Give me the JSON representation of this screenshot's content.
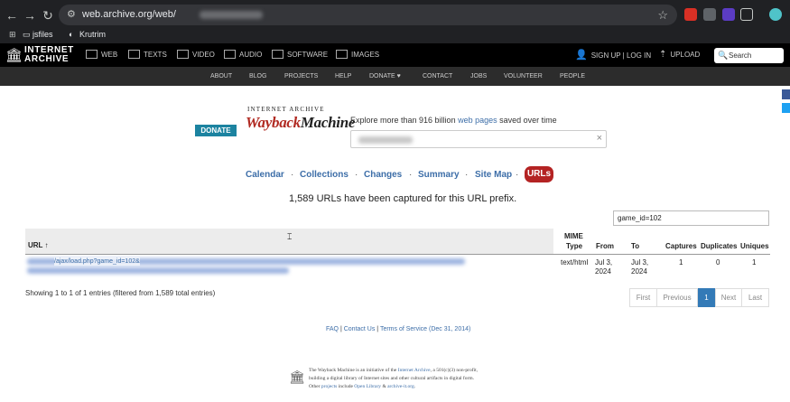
{
  "browser": {
    "url_visible": "web.archive.org/web/",
    "bookmarks": [
      "jsfiles",
      "Krutrim"
    ],
    "icons": [
      "back-icon",
      "forward-icon",
      "reload-icon",
      "site-info-icon",
      "star-icon",
      "apps-icon"
    ]
  },
  "ia_top": {
    "logo_line1": "INTERNET",
    "logo_line2": "ARCHIVE",
    "items": [
      "WEB",
      "TEXTS",
      "VIDEO",
      "AUDIO",
      "SOFTWARE",
      "IMAGES"
    ],
    "signup": "SIGN UP | LOG IN",
    "upload": "UPLOAD",
    "search_placeholder": "Search"
  },
  "ia_sub": [
    "ABOUT",
    "BLOG",
    "PROJECTS",
    "HELP",
    "DONATE ♥",
    "CONTACT",
    "JOBS",
    "VOLUNTEER",
    "PEOPLE"
  ],
  "wayback": {
    "donate": "DONATE",
    "logo_top": "INTERNET ARCHIVE",
    "logo_way": "WaybackMachine",
    "explore_prefix": "Explore more than 916 billion ",
    "explore_link": "web pages",
    "explore_suffix": " saved over time"
  },
  "tabs": [
    "Calendar",
    "Collections",
    "Changes",
    "Summary",
    "Site Map",
    "URLs"
  ],
  "captured_msg": "1,589 URLs have been captured for this URL prefix.",
  "filter_value": "game_id=102",
  "table": {
    "headers": {
      "url": "URL ↑",
      "mime1": "MIME",
      "mime2": "Type",
      "from": "From",
      "to": "To",
      "captures": "Captures",
      "duplicates": "Duplicates",
      "uniques": "Uniques"
    },
    "row": {
      "url_visible": "/ajax/load.php?game_id=102&",
      "mime": "text/html",
      "from1": "Jul 3,",
      "from2": "2024",
      "to1": "Jul 3,",
      "to2": "2024",
      "captures": "1",
      "duplicates": "0",
      "uniques": "1"
    }
  },
  "showing": "Showing 1 to 1 of 1 entries (filtered from 1,589 total entries)",
  "pagination": [
    "First",
    "Previous",
    "1",
    "Next",
    "Last"
  ],
  "footer": {
    "faq": "FAQ",
    "sep": " | ",
    "contact": "Contact Us",
    "tos": "Terms of Service (Dec 31, 2014)"
  },
  "bottom": {
    "l1a": "The Wayback Machine is an initiative of the ",
    "l1b": "Internet Archive",
    "l1c": ", a 501(c)(3) non-profit,",
    "l2": "building a digital library of Internet sites and other cultural artifacts in digital form.",
    "l3a": "Other ",
    "l3b": "projects",
    "l3c": " include ",
    "l3d": "Open Library",
    "l3e": " & ",
    "l3f": "archive-it.org",
    "l3g": "."
  },
  "colors": {
    "chrome_bg": "#202124",
    "ia_black": "#000000",
    "sub_nav": "#2c2c2c",
    "wayback_red": "#b42323",
    "link_blue": "#3d6ea8",
    "donate_teal": "#1c83a0",
    "active_page": "#337ab7"
  }
}
